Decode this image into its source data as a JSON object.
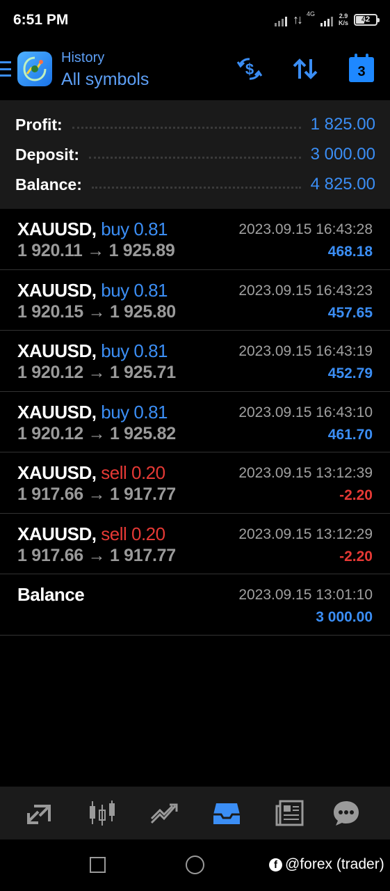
{
  "status_bar": {
    "time": "6:51 PM",
    "network": "4G",
    "speed_value": "2.9",
    "speed_unit": "K/s",
    "battery": "42"
  },
  "toolbar": {
    "subtitle": "History",
    "title": "All symbols",
    "calendar_day": "3",
    "accent_color": "#3b8ef5"
  },
  "summary": {
    "profit_label": "Profit:",
    "profit_value": "1 825.00",
    "deposit_label": "Deposit:",
    "deposit_value": "3 000.00",
    "balance_label": "Balance:",
    "balance_value": "4 825.00"
  },
  "deals": [
    {
      "symbol": "XAUUSD,",
      "side": "buy",
      "volume": "0.81",
      "open": "1 920.11",
      "arrow": "→",
      "close": "1 925.89",
      "time": "2023.09.15 16:43:28",
      "profit": "468.18"
    },
    {
      "symbol": "XAUUSD,",
      "side": "buy",
      "volume": "0.81",
      "open": "1 920.15",
      "arrow": "→",
      "close": "1 925.80",
      "time": "2023.09.15 16:43:23",
      "profit": "457.65"
    },
    {
      "symbol": "XAUUSD,",
      "side": "buy",
      "volume": "0.81",
      "open": "1 920.12",
      "arrow": "→",
      "close": "1 925.71",
      "time": "2023.09.15 16:43:19",
      "profit": "452.79"
    },
    {
      "symbol": "XAUUSD,",
      "side": "buy",
      "volume": "0.81",
      "open": "1 920.12",
      "arrow": "→",
      "close": "1 925.82",
      "time": "2023.09.15 16:43:10",
      "profit": "461.70"
    },
    {
      "symbol": "XAUUSD,",
      "side": "sell",
      "volume": "0.20",
      "open": "1 917.66",
      "arrow": "→",
      "close": "1 917.77",
      "time": "2023.09.15 13:12:39",
      "profit": "-2.20"
    },
    {
      "symbol": "XAUUSD,",
      "side": "sell",
      "volume": "0.20",
      "open": "1 917.66",
      "arrow": "→",
      "close": "1 917.77",
      "time": "2023.09.15 13:12:29",
      "profit": "-2.20"
    }
  ],
  "balance_entry": {
    "label": "Balance",
    "time": "2023.09.15 13:01:10",
    "amount": "3 000.00"
  },
  "bottom_nav": {
    "items": [
      "quotes-icon",
      "chart-icon",
      "trade-icon",
      "history-icon",
      "news-icon",
      "chat-icon"
    ],
    "active": "history-icon"
  },
  "watermark": "@forex (trader)"
}
